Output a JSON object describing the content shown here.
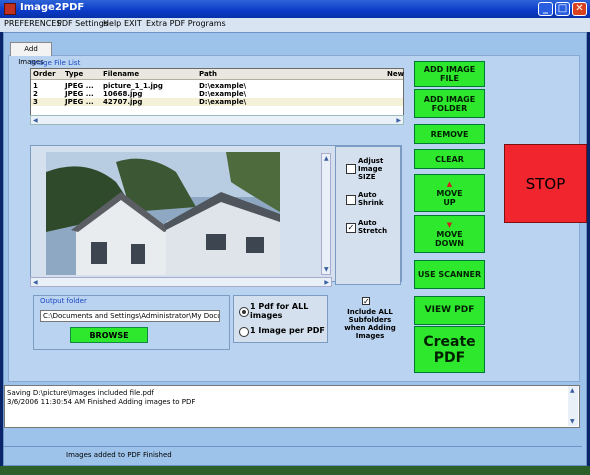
{
  "window": {
    "title": "Image2PDF",
    "minimize": "_",
    "maximize": "□",
    "close": "✕"
  },
  "menu": [
    "PREFERENCES",
    "PDF Settings",
    "Help",
    "EXIT",
    "Extra PDF Programs"
  ],
  "tabs": [
    {
      "label": "Add Images"
    }
  ],
  "file_list": {
    "group_label": "Image File List",
    "columns": [
      "Order",
      "Type",
      "Filename",
      "Path",
      "New"
    ],
    "rows": [
      {
        "order": "1",
        "type": "JPEG ...",
        "filename": "picture_1_1.jpg",
        "path": "D:\\example\\"
      },
      {
        "order": "2",
        "type": "JPEG ...",
        "filename": "10668.jpg",
        "path": "D:\\example\\"
      },
      {
        "order": "3",
        "type": "JPEG ...",
        "filename": "42707.jpg",
        "path": "D:\\example\\"
      }
    ]
  },
  "options": {
    "adjust_size": {
      "label": "Adjust Image SIZE",
      "checked": false
    },
    "auto_shrink": {
      "label": "Auto Shrink",
      "checked": false
    },
    "auto_stretch": {
      "label": "Auto Stretch",
      "checked": true
    }
  },
  "output": {
    "group_label": "Output folder",
    "path": "C:\\Documents and Settings\\Administrator\\My Documents",
    "browse_label": "BROWSE"
  },
  "pdf_mode": {
    "options": [
      "1 Pdf for ALL images",
      "1 Image per PDF"
    ],
    "selected": "1 Pdf for ALL images"
  },
  "include_subfolders": {
    "label": "Include ALL Subfolders when Adding Images",
    "checked": true
  },
  "buttons": {
    "add_image_file": "ADD IMAGE FILE",
    "add_image_folder": "ADD IMAGE FOLDER",
    "remove": "REMOVE",
    "clear": "CLEAR",
    "move_up": "MOVE UP",
    "move_down": "MOVE DOWN",
    "use_scanner": "USE SCANNER",
    "view_pdf": "VIEW PDF",
    "create_pdf": "Create PDF",
    "stop": "STOP"
  },
  "log": [
    "Saving D:\\picture\\Images included file.pdf",
    "3/6/2006 11:30:54 AM Finished Adding images to PDF"
  ],
  "status": "Images added to PDF Finished",
  "colors": {
    "green_button": "#2ee82e",
    "stop_button": "#f0252d",
    "panel": "#b9d3f0"
  }
}
